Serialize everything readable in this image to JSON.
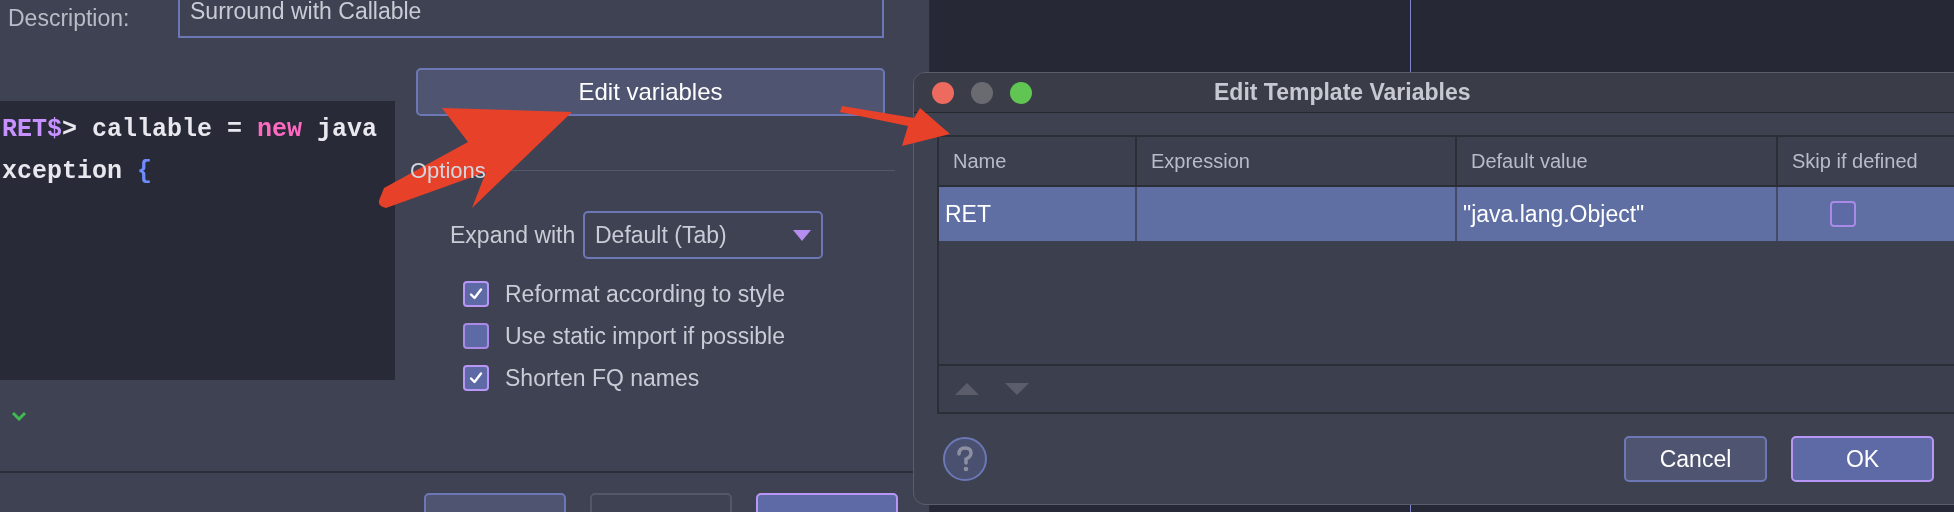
{
  "template_dialog": {
    "description_label": "Description:",
    "description_value": "Surround with Callable",
    "edit_variables_button": "Edit variables",
    "code_lines": [
      {
        "tokens": [
          {
            "text": "RET$",
            "kind": "variable"
          },
          {
            "text": "> callable = ",
            "kind": "plain"
          },
          {
            "text": "new",
            "kind": "keyword"
          },
          {
            "text": " java",
            "kind": "plain"
          }
        ]
      },
      {
        "tokens": [
          {
            "text": "xception ",
            "kind": "plain"
          },
          {
            "text": "{",
            "kind": "brace"
          }
        ]
      }
    ],
    "options_title": "Options",
    "expand_with": {
      "label": "Expand with",
      "value": "Default (Tab)"
    },
    "options": [
      {
        "label": "Reformat according to style",
        "checked": true
      },
      {
        "label": "Use static import if possible",
        "checked": false
      },
      {
        "label": "Shorten FQ names",
        "checked": true
      }
    ]
  },
  "variables_dialog": {
    "title": "Edit Template Variables",
    "columns": [
      "Name",
      "Expression",
      "Default value",
      "Skip if defined"
    ],
    "rows": [
      {
        "name": "RET",
        "expression": "",
        "default_value": "\"java.lang.Object\"",
        "skip_if_defined": false,
        "selected": true
      }
    ],
    "buttons": [
      {
        "label": "Cancel",
        "kind": "secondary"
      },
      {
        "label": "OK",
        "kind": "primary"
      }
    ]
  }
}
